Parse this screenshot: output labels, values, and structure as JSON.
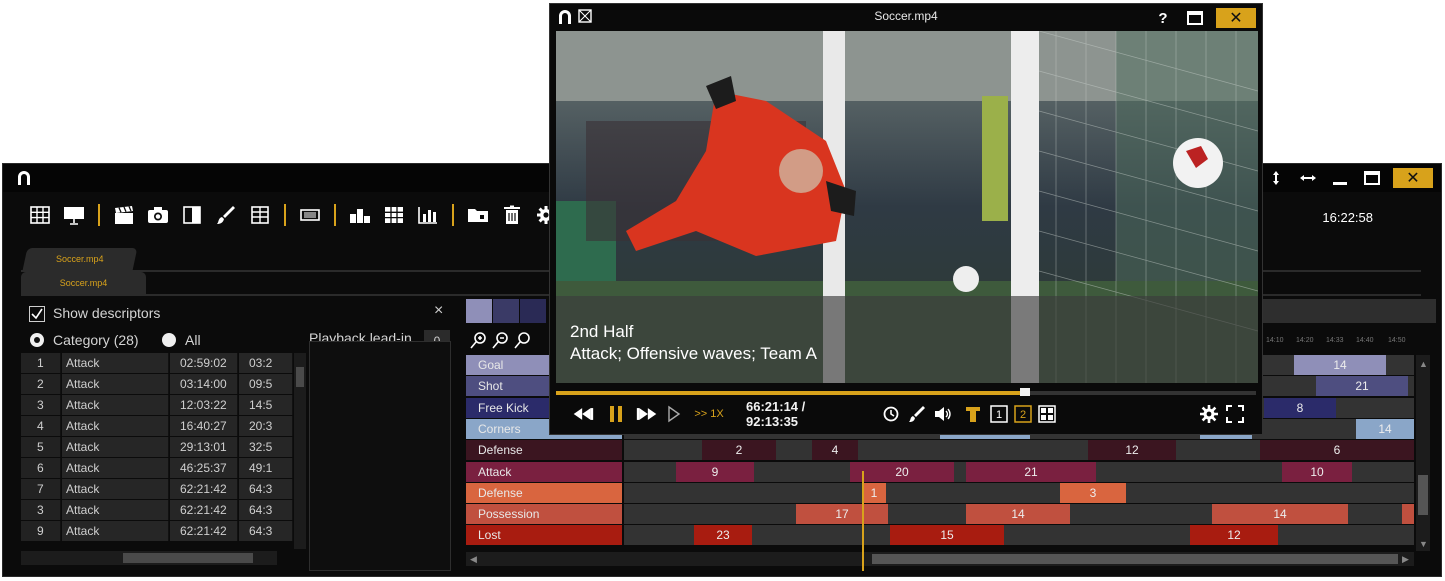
{
  "main": {
    "clock": "16:22:58",
    "window_controls": {
      "help": "?",
      "close": "✕"
    },
    "toolbar_icons": [
      "grid-icon",
      "presentation-icon",
      "clapperboard-icon",
      "camera-icon",
      "split-view-icon",
      "brush-icon",
      "table-icon",
      "menu-box-icon",
      "ranking-icon",
      "matrix-icon",
      "bar-chart-icon",
      "folder-icon",
      "trash-icon",
      "gear-icon"
    ],
    "tabs": [
      "Soccer.mp4",
      "Soccer.mp4"
    ],
    "show_descriptors_label": "Show descriptors",
    "radio_category_label": "Category (28)",
    "radio_all_label": "All",
    "playback_leadin_label": "Playback lead-in",
    "playback_leadin_value": "0",
    "close_x": "×",
    "events": [
      {
        "num": "1",
        "category": "Attack",
        "start": "02:59:02",
        "end": "03:2"
      },
      {
        "num": "2",
        "category": "Attack",
        "start": "03:14:00",
        "end": "09:5"
      },
      {
        "num": "3",
        "category": "Attack",
        "start": "12:03:22",
        "end": "14:5"
      },
      {
        "num": "4",
        "category": "Attack",
        "start": "16:40:27",
        "end": "20:3"
      },
      {
        "num": "5",
        "category": "Attack",
        "start": "29:13:01",
        "end": "32:5"
      },
      {
        "num": "6",
        "category": "Attack",
        "start": "46:25:37",
        "end": "49:1"
      },
      {
        "num": "7",
        "category": "Attack",
        "start": "62:21:42",
        "end": "64:3"
      },
      {
        "num": "3",
        "category": "Attack",
        "start": "62:21:42",
        "end": "64:3"
      },
      {
        "num": "9",
        "category": "Attack",
        "start": "62:21:42",
        "end": "64:3"
      }
    ],
    "timeline": {
      "swatches": [
        "#8f8fb8",
        "#3a3a66",
        "#2a2a55"
      ],
      "tick_labels": [
        "14:10",
        "14:20",
        "14:33",
        "14:40",
        "14:50"
      ],
      "tracks": [
        {
          "label": "Goal",
          "label_color": "#8f8fb8",
          "seg_color": "#8f8fb8",
          "segments": [
            {
              "value": "14"
            }
          ]
        },
        {
          "label": "Shot",
          "label_color": "#4e4e80",
          "seg_color": "#4e4e80",
          "segments": [
            {
              "value": "21"
            }
          ]
        },
        {
          "label": "Free Kick",
          "label_color": "#2b2b6a",
          "seg_color": "#2b2b6a",
          "segments": [
            {
              "value": "8"
            }
          ]
        },
        {
          "label": "Corners",
          "label_color": "#8aa6c8",
          "seg_color": "#8aa6c8",
          "segments": [
            {
              "value": ""
            },
            {
              "value": ""
            },
            {
              "value": "14"
            }
          ]
        },
        {
          "label": "Defense",
          "label_color": "#3b1520",
          "seg_color": "#3b1520",
          "segments": [
            {
              "value": "2"
            },
            {
              "value": "4"
            },
            {
              "value": "12"
            },
            {
              "value": "6"
            }
          ]
        },
        {
          "label": "Attack",
          "label_color": "#7a2040",
          "seg_color": "#7a2040",
          "segments": [
            {
              "value": "9"
            },
            {
              "value": "20"
            },
            {
              "value": "21"
            },
            {
              "value": "10"
            }
          ]
        },
        {
          "label": "Defense",
          "label_color": "#d9653f",
          "seg_color": "#d9653f",
          "segments": [
            {
              "value": "1"
            },
            {
              "value": "3"
            }
          ]
        },
        {
          "label": "Possession",
          "label_color": "#c0503f",
          "seg_color": "#c0503f",
          "segments": [
            {
              "value": "17"
            },
            {
              "value": "14"
            },
            {
              "value": "14"
            },
            {
              "value": ""
            }
          ]
        },
        {
          "label": "Lost",
          "label_color": "#a81c10",
          "seg_color": "#a81c10",
          "segments": [
            {
              "value": "23"
            },
            {
              "value": "15"
            },
            {
              "value": "12"
            }
          ]
        }
      ]
    }
  },
  "video": {
    "title": "Soccer.mp4",
    "overlay_line1": "2nd Half",
    "overlay_line2": "Attack; Offensive waves; Team A",
    "speed": ">> 1X",
    "timecode": "66:21:14 / 92:13:35",
    "progress_fraction": 0.67,
    "help": "?",
    "close": "✕",
    "layout_options": [
      "1",
      "2"
    ]
  },
  "colors": {
    "accent": "#d8a21b",
    "background": "#0b0b0b"
  }
}
